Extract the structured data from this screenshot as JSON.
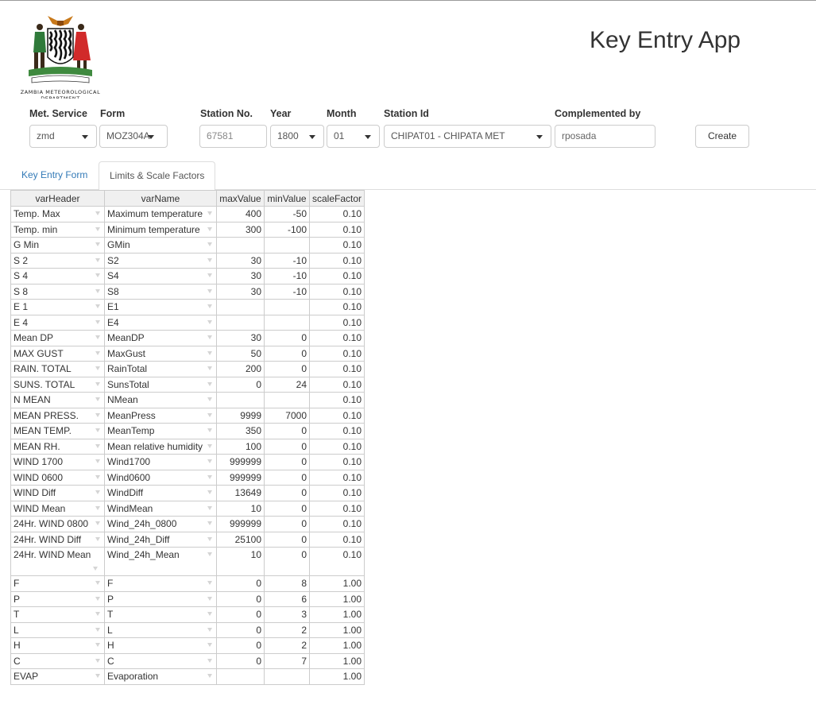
{
  "logo": {
    "line1": "ZAMBIA METEOROLOGICAL",
    "line2": "DEPARTMENT"
  },
  "app_title": "Key Entry App",
  "form": {
    "met_service": {
      "label": "Met. Service",
      "value": "zmd"
    },
    "form": {
      "label": "Form",
      "value": "MOZ304A"
    },
    "station_no": {
      "label": "Station No.",
      "placeholder": "67581"
    },
    "year": {
      "label": "Year",
      "value": "1800"
    },
    "month": {
      "label": "Month",
      "value": "01"
    },
    "station_id": {
      "label": "Station Id",
      "value": "CHIPAT01 - CHIPATA MET"
    },
    "complemented_by": {
      "label": "Complemented by",
      "value": "rposada"
    },
    "create_label": "Create"
  },
  "tabs": [
    {
      "label": "Key Entry Form",
      "active": false
    },
    {
      "label": "Limits & Scale Factors",
      "active": true
    }
  ],
  "table": {
    "headers": [
      "varHeader",
      "varName",
      "maxValue",
      "minValue",
      "scaleFactor"
    ],
    "rows": [
      [
        "Temp. Max",
        "Maximum temperature",
        "400",
        "-50",
        "0.10"
      ],
      [
        "Temp. min",
        "Minimum temperature",
        "300",
        "-100",
        "0.10"
      ],
      [
        "G Min",
        "GMin",
        "",
        "",
        "0.10"
      ],
      [
        "S 2",
        "S2",
        "30",
        "-10",
        "0.10"
      ],
      [
        "S 4",
        "S4",
        "30",
        "-10",
        "0.10"
      ],
      [
        "S 8",
        "S8",
        "30",
        "-10",
        "0.10"
      ],
      [
        "E 1",
        "E1",
        "",
        "",
        "0.10"
      ],
      [
        "E 4",
        "E4",
        "",
        "",
        "0.10"
      ],
      [
        "Mean DP",
        "MeanDP",
        "30",
        "0",
        "0.10"
      ],
      [
        "MAX GUST",
        "MaxGust",
        "50",
        "0",
        "0.10"
      ],
      [
        "RAIN. TOTAL",
        "RainTotal",
        "200",
        "0",
        "0.10"
      ],
      [
        "SUNS. TOTAL",
        "SunsTotal",
        "0",
        "24",
        "0.10"
      ],
      [
        "N MEAN",
        "NMean",
        "",
        "",
        "0.10"
      ],
      [
        "MEAN PRESS.",
        "MeanPress",
        "9999",
        "7000",
        "0.10"
      ],
      [
        "MEAN TEMP.",
        "MeanTemp",
        "350",
        "0",
        "0.10"
      ],
      [
        "MEAN RH.",
        "Mean relative humidity",
        "100",
        "0",
        "0.10"
      ],
      [
        "WIND 1700",
        "Wind1700",
        "999999",
        "0",
        "0.10"
      ],
      [
        "WIND 0600",
        "Wind0600",
        "999999",
        "0",
        "0.10"
      ],
      [
        "WIND Diff",
        "WindDiff",
        "13649",
        "0",
        "0.10"
      ],
      [
        "WIND Mean",
        "WindMean",
        "10",
        "0",
        "0.10"
      ],
      [
        "24Hr. WIND 0800",
        "Wind_24h_0800",
        "999999",
        "0",
        "0.10"
      ],
      [
        "24Hr. WIND Diff",
        "Wind_24h_Diff",
        "25100",
        "0",
        "0.10"
      ],
      [
        "24Hr. WIND Mean",
        "Wind_24h_Mean",
        "10",
        "0",
        "0.10"
      ],
      [
        "F",
        "F",
        "0",
        "8",
        "1.00"
      ],
      [
        "P",
        "P",
        "0",
        "6",
        "1.00"
      ],
      [
        "T",
        "T",
        "0",
        "3",
        "1.00"
      ],
      [
        "L",
        "L",
        "0",
        "2",
        "1.00"
      ],
      [
        "H",
        "H",
        "0",
        "2",
        "1.00"
      ],
      [
        "C",
        "C",
        "0",
        "7",
        "1.00"
      ],
      [
        "EVAP",
        "Evaporation",
        "",
        "",
        "1.00"
      ]
    ]
  }
}
